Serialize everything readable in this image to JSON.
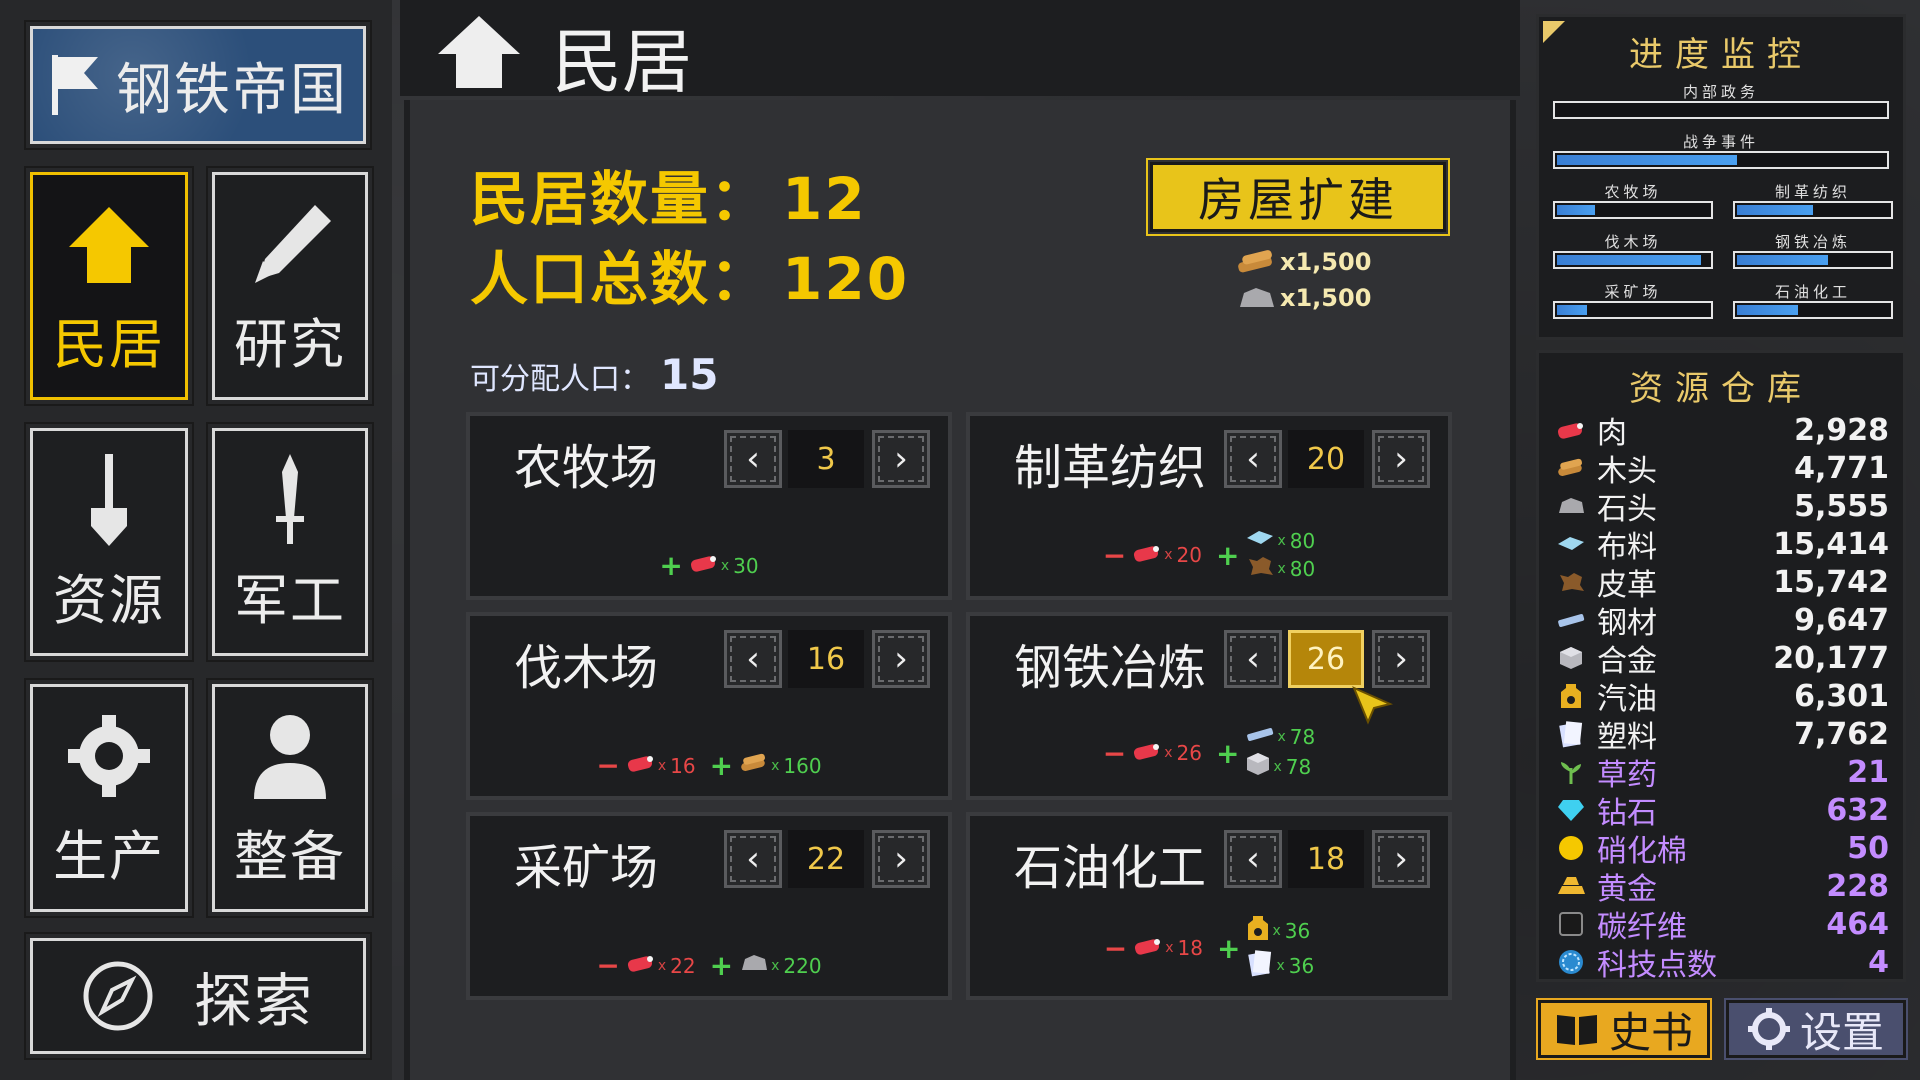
{
  "app": {
    "title": "钢铁帝国"
  },
  "nav": {
    "items": [
      {
        "id": "housing",
        "label": "民居",
        "active": true
      },
      {
        "id": "research",
        "label": "研究"
      },
      {
        "id": "resources",
        "label": "资源"
      },
      {
        "id": "military",
        "label": "军工"
      },
      {
        "id": "production",
        "label": "生产"
      },
      {
        "id": "equip",
        "label": "整备"
      }
    ],
    "explore_label": "探索"
  },
  "header": {
    "title": "民居"
  },
  "stats": {
    "housing_count_label": "民居数量：",
    "housing_count": "12",
    "population_label": "人口总数：",
    "population": "120",
    "available_label": "可分配人口：",
    "available": "15"
  },
  "expand": {
    "label": "房屋扩建",
    "costs": [
      {
        "icon": "wood-icon",
        "amount": "x1,500"
      },
      {
        "icon": "stone-icon",
        "amount": "x1,500"
      }
    ]
  },
  "facilities": [
    {
      "name": "农牧场",
      "value": "3",
      "effects": [
        {
          "sign": "+",
          "icon": "meat-icon",
          "amount": "30"
        }
      ]
    },
    {
      "name": "制革纺织",
      "value": "20",
      "effects": [
        {
          "sign": "−",
          "icon": "meat-icon",
          "amount": "20"
        }
      ],
      "outputs": [
        {
          "icon": "cloth-icon",
          "amount": "80"
        },
        {
          "icon": "leather-icon",
          "amount": "80"
        }
      ]
    },
    {
      "name": "伐木场",
      "value": "16",
      "effects": [
        {
          "sign": "−",
          "icon": "meat-icon",
          "amount": "16"
        },
        {
          "sign": "+",
          "icon": "wood-icon",
          "amount": "160"
        }
      ]
    },
    {
      "name": "钢铁冶炼",
      "value": "26",
      "focused": true,
      "effects": [
        {
          "sign": "−",
          "icon": "meat-icon",
          "amount": "26"
        }
      ],
      "outputs": [
        {
          "icon": "steel-icon",
          "amount": "78"
        },
        {
          "icon": "alloy-icon",
          "amount": "78"
        }
      ]
    },
    {
      "name": "采矿场",
      "value": "22",
      "effects": [
        {
          "sign": "−",
          "icon": "meat-icon",
          "amount": "22"
        },
        {
          "sign": "+",
          "icon": "stone-icon",
          "amount": "220"
        }
      ]
    },
    {
      "name": "石油化工",
      "value": "18",
      "effects": [
        {
          "sign": "−",
          "icon": "meat-icon",
          "amount": "18"
        }
      ],
      "outputs": [
        {
          "icon": "oil-icon",
          "amount": "36"
        },
        {
          "icon": "plastic-icon",
          "amount": "36"
        }
      ]
    }
  ],
  "monitor": {
    "title": "进度监控",
    "bars": [
      {
        "label": "内部政务",
        "progress": 0.0
      },
      {
        "label": "战争事件",
        "progress": 0.55
      },
      {
        "label": "农牧场",
        "progress": 0.25
      },
      {
        "label": "制革纺织",
        "progress": 0.5
      },
      {
        "label": "伐木场",
        "progress": 0.95
      },
      {
        "label": "钢铁冶炼",
        "progress": 0.6
      },
      {
        "label": "采矿场",
        "progress": 0.2
      },
      {
        "label": "石油化工",
        "progress": 0.4
      }
    ]
  },
  "warehouse": {
    "title": "资源仓库",
    "items": [
      {
        "icon": "meat-icon",
        "name": "肉",
        "value": "2,928",
        "rare": false
      },
      {
        "icon": "wood-icon",
        "name": "木头",
        "value": "4,771",
        "rare": false
      },
      {
        "icon": "stone-icon",
        "name": "石头",
        "value": "5,555",
        "rare": false
      },
      {
        "icon": "cloth-icon",
        "name": "布料",
        "value": "15,414",
        "rare": false
      },
      {
        "icon": "leather-icon",
        "name": "皮革",
        "value": "15,742",
        "rare": false
      },
      {
        "icon": "steel-icon",
        "name": "钢材",
        "value": "9,647",
        "rare": false
      },
      {
        "icon": "alloy-icon",
        "name": "合金",
        "value": "20,177",
        "rare": false
      },
      {
        "icon": "oil-icon",
        "name": "汽油",
        "value": "6,301",
        "rare": false
      },
      {
        "icon": "plastic-icon",
        "name": "塑料",
        "value": "7,762",
        "rare": false
      },
      {
        "icon": "herb-icon",
        "name": "草药",
        "value": "21",
        "rare": true
      },
      {
        "icon": "diamond-icon",
        "name": "钻石",
        "value": "632",
        "rare": true
      },
      {
        "icon": "nitro-icon",
        "name": "硝化棉",
        "value": "50",
        "rare": true
      },
      {
        "icon": "gold-icon",
        "name": "黄金",
        "value": "228",
        "rare": true
      },
      {
        "icon": "carbon-icon",
        "name": "碳纤维",
        "value": "464",
        "rare": true
      },
      {
        "icon": "tech-icon",
        "name": "科技点数",
        "value": "4",
        "rare": true
      }
    ]
  },
  "buttons": {
    "history": "史书",
    "settings": "设置"
  },
  "colors": {
    "accent": "#f5c800",
    "positive": "#4fcf4f",
    "negative": "#e84747",
    "rare": "#c38cff",
    "progress": "#3a7fd4"
  }
}
